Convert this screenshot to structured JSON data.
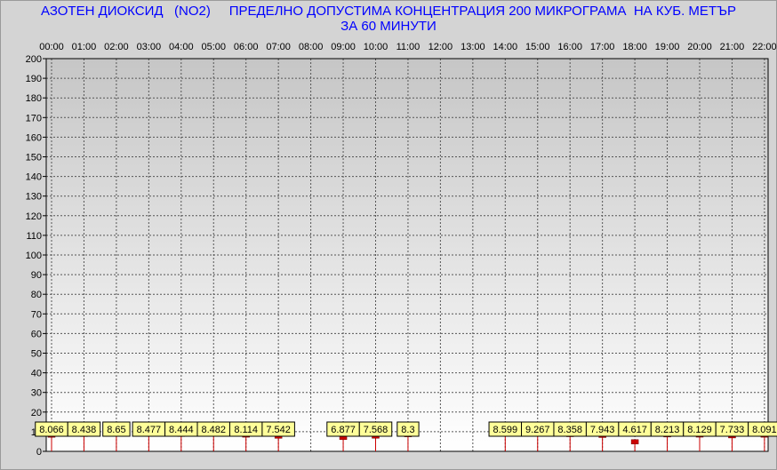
{
  "chart_data": {
    "type": "line",
    "title": "АЗОТЕН ДИОКСИД   (NO2)     ПРЕДЕЛНО ДОПУСТИМА КОНЦЕНТРАЦИЯ 200 МИКРОГРАМА  НА КУБ. МЕТЪР",
    "subtitle": "ЗА 60 МИНУТИ",
    "xlabel": "",
    "ylabel": "",
    "ylim": [
      0,
      200
    ],
    "yticks": [
      "0",
      "10",
      "20",
      "30",
      "40",
      "50",
      "60",
      "70",
      "80",
      "90",
      "100",
      "110",
      "120",
      "130",
      "140",
      "150",
      "160",
      "170",
      "180",
      "190",
      "200"
    ],
    "categories": [
      "00:00",
      "01:00",
      "02:00",
      "03:00",
      "04:00",
      "05:00",
      "06:00",
      "07:00",
      "08:00",
      "09:00",
      "10:00",
      "11:00",
      "12:00",
      "13:00",
      "14:00",
      "15:00",
      "16:00",
      "17:00",
      "18:00",
      "19:00",
      "20:00",
      "21:00",
      "22:00"
    ],
    "grid": true,
    "series": [
      {
        "color": "#cc0000",
        "values": [
          8.066,
          8.438,
          8.65,
          8.477,
          8.444,
          8.482,
          8.114,
          7.542,
          null,
          6.877,
          7.568,
          8.3,
          null,
          null,
          8.599,
          9.267,
          8.358,
          7.943,
          4.617,
          8.213,
          8.129,
          7.733,
          8.091
        ],
        "labels": [
          "8.066",
          "8.438",
          "8.65",
          "8.477",
          "8.444",
          "8.482",
          "8.114",
          "7.542",
          "",
          "6.877",
          "7.568",
          "8.3",
          "",
          "",
          "8.599",
          "9.267",
          "8.358",
          "7.943",
          "4.617",
          "8.213",
          "8.129",
          "7.733",
          "8.091"
        ]
      }
    ]
  }
}
